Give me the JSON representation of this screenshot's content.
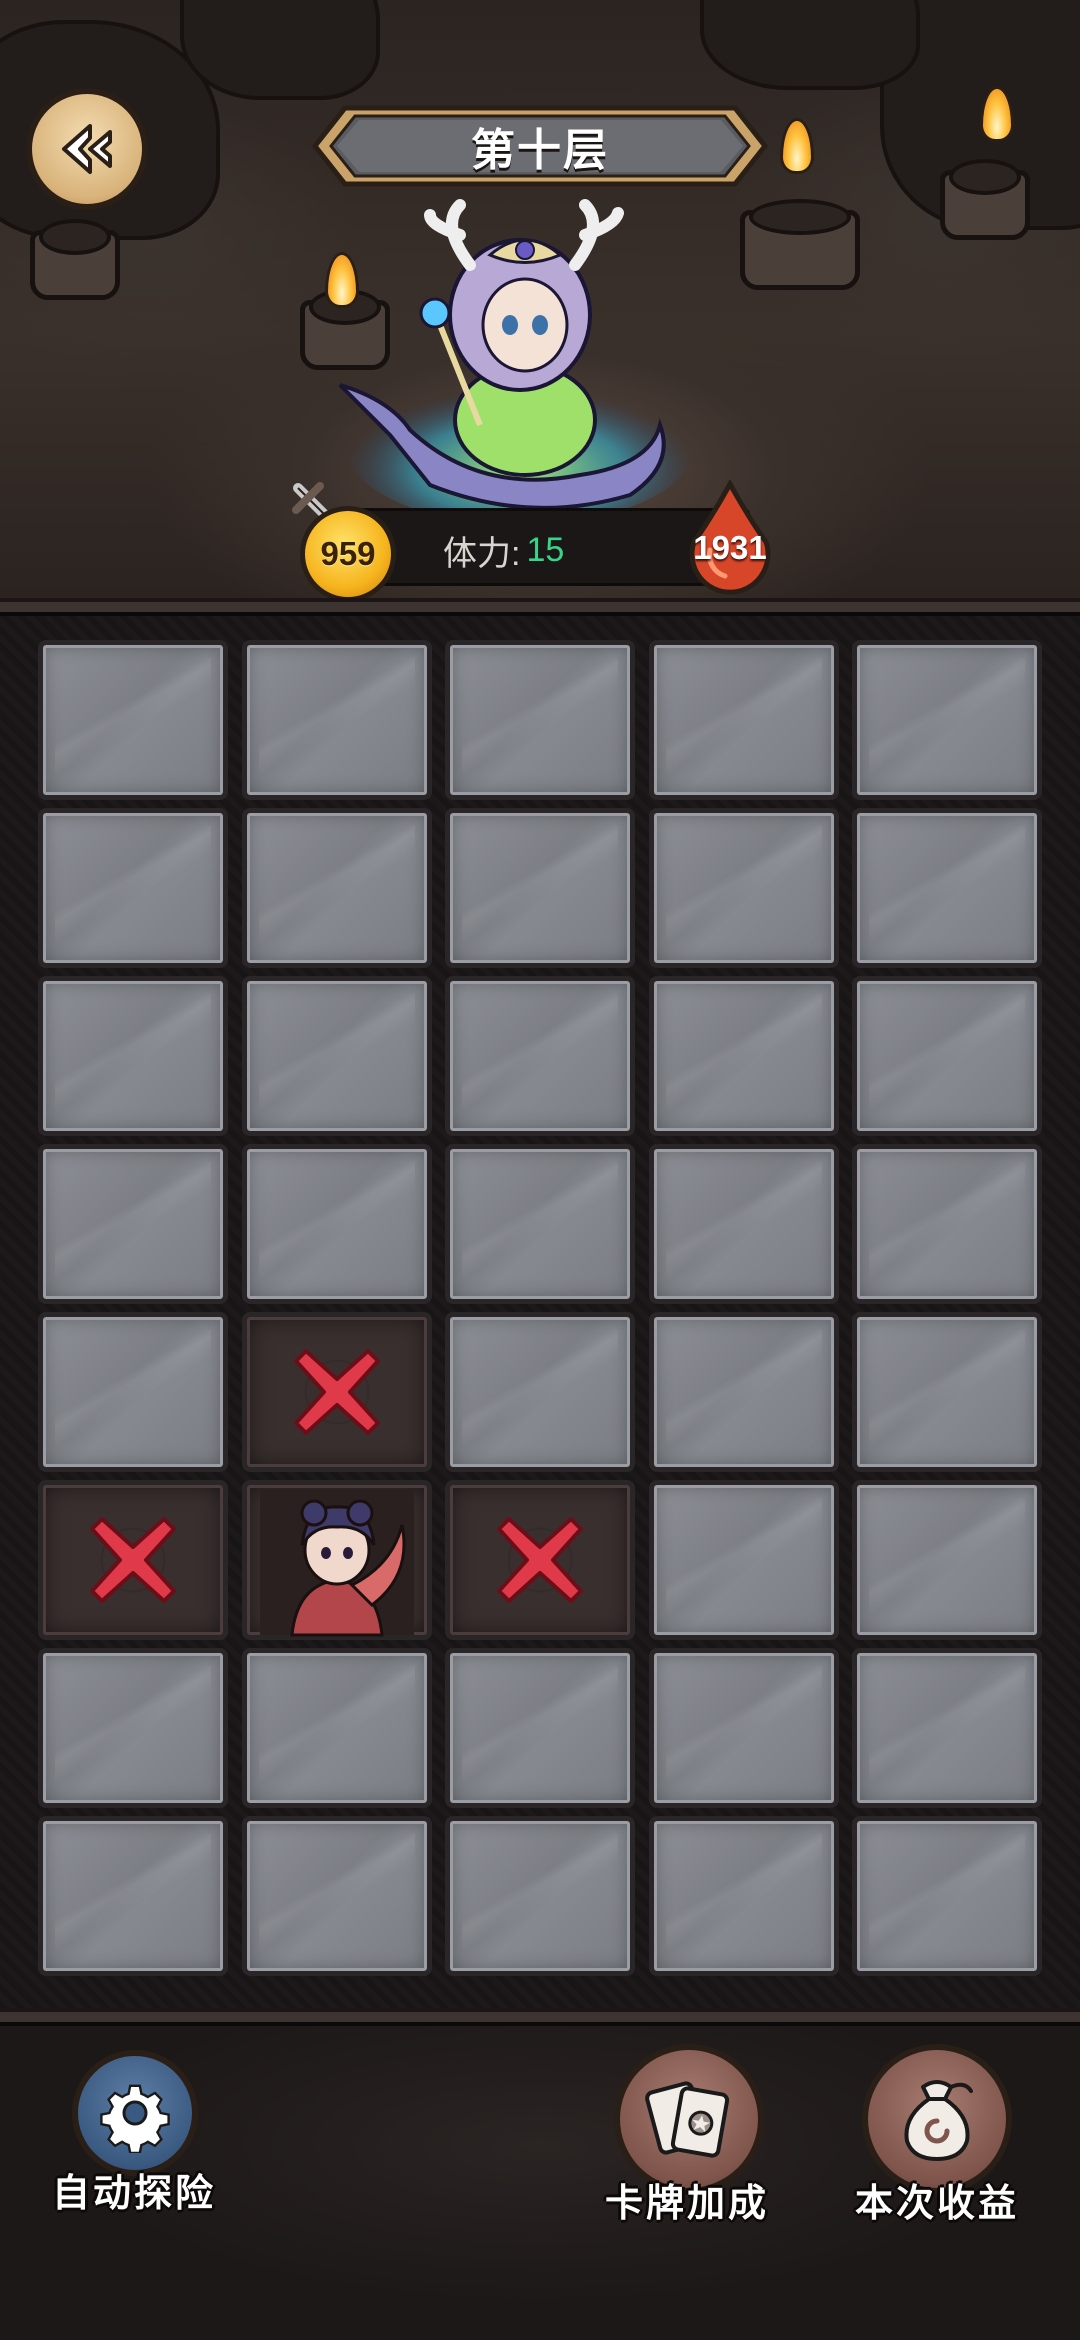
{
  "header": {
    "level_title": "第十层"
  },
  "stats": {
    "attack": "959",
    "stamina_label": "体力:",
    "stamina_value": "15",
    "hp": "1931"
  },
  "board": {
    "columns": 5,
    "rows": 8,
    "cells": [
      [
        "closed",
        "closed",
        "closed",
        "closed",
        "closed"
      ],
      [
        "closed",
        "closed",
        "closed",
        "closed",
        "closed"
      ],
      [
        "closed",
        "closed",
        "closed",
        "closed",
        "closed"
      ],
      [
        "closed",
        "closed",
        "closed",
        "closed",
        "closed"
      ],
      [
        "closed",
        "blocked",
        "closed",
        "closed",
        "closed"
      ],
      [
        "blocked",
        "hero",
        "blocked",
        "closed",
        "closed"
      ],
      [
        "closed",
        "closed",
        "closed",
        "closed",
        "closed"
      ],
      [
        "closed",
        "closed",
        "closed",
        "closed",
        "closed"
      ]
    ]
  },
  "actions": {
    "auto_explore": "自动探险",
    "card_bonus": "卡牌加成",
    "earnings": "本次收益"
  },
  "icons": {
    "back": "back-arrow-icon",
    "auto_explore": "gear-icon",
    "card_bonus": "cards-icon",
    "earnings": "money-bag-icon"
  },
  "colors": {
    "stamina_value": "#35d58a",
    "blocked_mark": "#e03a4a",
    "tile": "#858890"
  }
}
